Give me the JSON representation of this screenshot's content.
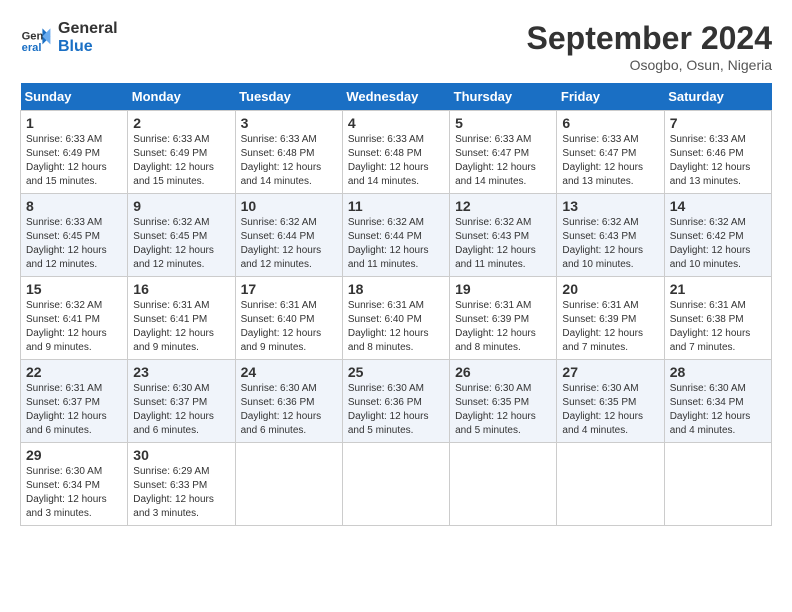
{
  "logo": {
    "text_general": "General",
    "text_blue": "Blue"
  },
  "title": "September 2024",
  "location": "Osogbo, Osun, Nigeria",
  "days_of_week": [
    "Sunday",
    "Monday",
    "Tuesday",
    "Wednesday",
    "Thursday",
    "Friday",
    "Saturday"
  ],
  "weeks": [
    [
      {
        "day": "1",
        "info": "Sunrise: 6:33 AM\nSunset: 6:49 PM\nDaylight: 12 hours and 15 minutes."
      },
      {
        "day": "2",
        "info": "Sunrise: 6:33 AM\nSunset: 6:49 PM\nDaylight: 12 hours and 15 minutes."
      },
      {
        "day": "3",
        "info": "Sunrise: 6:33 AM\nSunset: 6:48 PM\nDaylight: 12 hours and 14 minutes."
      },
      {
        "day": "4",
        "info": "Sunrise: 6:33 AM\nSunset: 6:48 PM\nDaylight: 12 hours and 14 minutes."
      },
      {
        "day": "5",
        "info": "Sunrise: 6:33 AM\nSunset: 6:47 PM\nDaylight: 12 hours and 14 minutes."
      },
      {
        "day": "6",
        "info": "Sunrise: 6:33 AM\nSunset: 6:47 PM\nDaylight: 12 hours and 13 minutes."
      },
      {
        "day": "7",
        "info": "Sunrise: 6:33 AM\nSunset: 6:46 PM\nDaylight: 12 hours and 13 minutes."
      }
    ],
    [
      {
        "day": "8",
        "info": "Sunrise: 6:33 AM\nSunset: 6:45 PM\nDaylight: 12 hours and 12 minutes."
      },
      {
        "day": "9",
        "info": "Sunrise: 6:32 AM\nSunset: 6:45 PM\nDaylight: 12 hours and 12 minutes."
      },
      {
        "day": "10",
        "info": "Sunrise: 6:32 AM\nSunset: 6:44 PM\nDaylight: 12 hours and 12 minutes."
      },
      {
        "day": "11",
        "info": "Sunrise: 6:32 AM\nSunset: 6:44 PM\nDaylight: 12 hours and 11 minutes."
      },
      {
        "day": "12",
        "info": "Sunrise: 6:32 AM\nSunset: 6:43 PM\nDaylight: 12 hours and 11 minutes."
      },
      {
        "day": "13",
        "info": "Sunrise: 6:32 AM\nSunset: 6:43 PM\nDaylight: 12 hours and 10 minutes."
      },
      {
        "day": "14",
        "info": "Sunrise: 6:32 AM\nSunset: 6:42 PM\nDaylight: 12 hours and 10 minutes."
      }
    ],
    [
      {
        "day": "15",
        "info": "Sunrise: 6:32 AM\nSunset: 6:41 PM\nDaylight: 12 hours and 9 minutes."
      },
      {
        "day": "16",
        "info": "Sunrise: 6:31 AM\nSunset: 6:41 PM\nDaylight: 12 hours and 9 minutes."
      },
      {
        "day": "17",
        "info": "Sunrise: 6:31 AM\nSunset: 6:40 PM\nDaylight: 12 hours and 9 minutes."
      },
      {
        "day": "18",
        "info": "Sunrise: 6:31 AM\nSunset: 6:40 PM\nDaylight: 12 hours and 8 minutes."
      },
      {
        "day": "19",
        "info": "Sunrise: 6:31 AM\nSunset: 6:39 PM\nDaylight: 12 hours and 8 minutes."
      },
      {
        "day": "20",
        "info": "Sunrise: 6:31 AM\nSunset: 6:39 PM\nDaylight: 12 hours and 7 minutes."
      },
      {
        "day": "21",
        "info": "Sunrise: 6:31 AM\nSunset: 6:38 PM\nDaylight: 12 hours and 7 minutes."
      }
    ],
    [
      {
        "day": "22",
        "info": "Sunrise: 6:31 AM\nSunset: 6:37 PM\nDaylight: 12 hours and 6 minutes."
      },
      {
        "day": "23",
        "info": "Sunrise: 6:30 AM\nSunset: 6:37 PM\nDaylight: 12 hours and 6 minutes."
      },
      {
        "day": "24",
        "info": "Sunrise: 6:30 AM\nSunset: 6:36 PM\nDaylight: 12 hours and 6 minutes."
      },
      {
        "day": "25",
        "info": "Sunrise: 6:30 AM\nSunset: 6:36 PM\nDaylight: 12 hours and 5 minutes."
      },
      {
        "day": "26",
        "info": "Sunrise: 6:30 AM\nSunset: 6:35 PM\nDaylight: 12 hours and 5 minutes."
      },
      {
        "day": "27",
        "info": "Sunrise: 6:30 AM\nSunset: 6:35 PM\nDaylight: 12 hours and 4 minutes."
      },
      {
        "day": "28",
        "info": "Sunrise: 6:30 AM\nSunset: 6:34 PM\nDaylight: 12 hours and 4 minutes."
      }
    ],
    [
      {
        "day": "29",
        "info": "Sunrise: 6:30 AM\nSunset: 6:34 PM\nDaylight: 12 hours and 3 minutes."
      },
      {
        "day": "30",
        "info": "Sunrise: 6:29 AM\nSunset: 6:33 PM\nDaylight: 12 hours and 3 minutes."
      },
      {
        "day": "",
        "info": ""
      },
      {
        "day": "",
        "info": ""
      },
      {
        "day": "",
        "info": ""
      },
      {
        "day": "",
        "info": ""
      },
      {
        "day": "",
        "info": ""
      }
    ]
  ]
}
